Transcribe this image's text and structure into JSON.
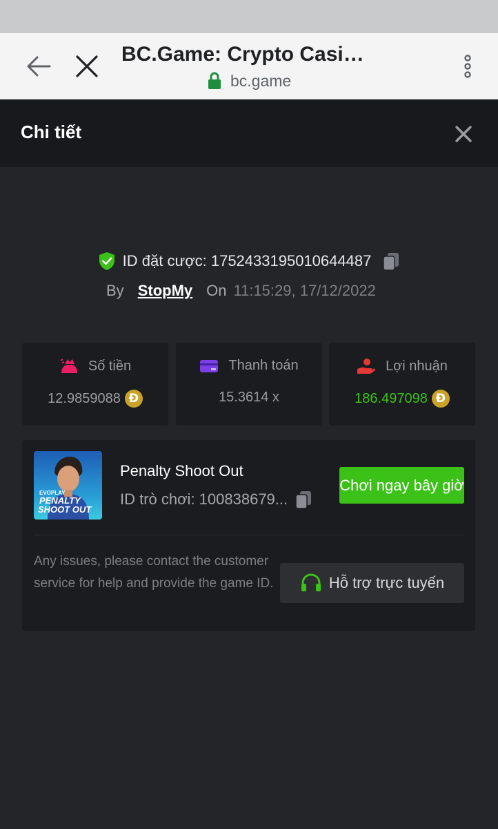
{
  "browser": {
    "title": "BC.Game: Crypto Casin…",
    "url": "bc.game"
  },
  "header": {
    "title": "Chi tiết"
  },
  "bet": {
    "id_label": "ID đặt cược: 1752433195010644487",
    "by_label": "By",
    "user": "StopMy",
    "on_label": "On",
    "time": "11:15:29, 17/12/2022"
  },
  "stats": [
    {
      "label": "Số tiền",
      "value": "12.9859088",
      "icon": "money-bag-icon",
      "color": "#e91e63"
    },
    {
      "label": "Thanh toán",
      "value": "15.3614 x",
      "icon": "card-icon",
      "color": "#7b3fe4"
    },
    {
      "label": "Lợi nhuận",
      "value": "186.497098",
      "icon": "profit-hand-icon",
      "color": "#e53935"
    }
  ],
  "coin_symbol": "Đ",
  "game": {
    "thumb_brand": "EVOPLAY",
    "thumb_line1": "PENALTY",
    "thumb_line2": "SHOOT OUT",
    "name": "Penalty Shoot Out",
    "id_label": "ID trò chơi: 100838679...",
    "play_label": "Chơi ngay bây giờ"
  },
  "help": {
    "text": "Any issues, please contact the customer service for help and provide the game ID.",
    "support_label": "Hỗ trợ trực tuyến"
  },
  "colors": {
    "accent_green": "#3bc117",
    "bg": "#232529",
    "panel": "#1b1c1f"
  }
}
